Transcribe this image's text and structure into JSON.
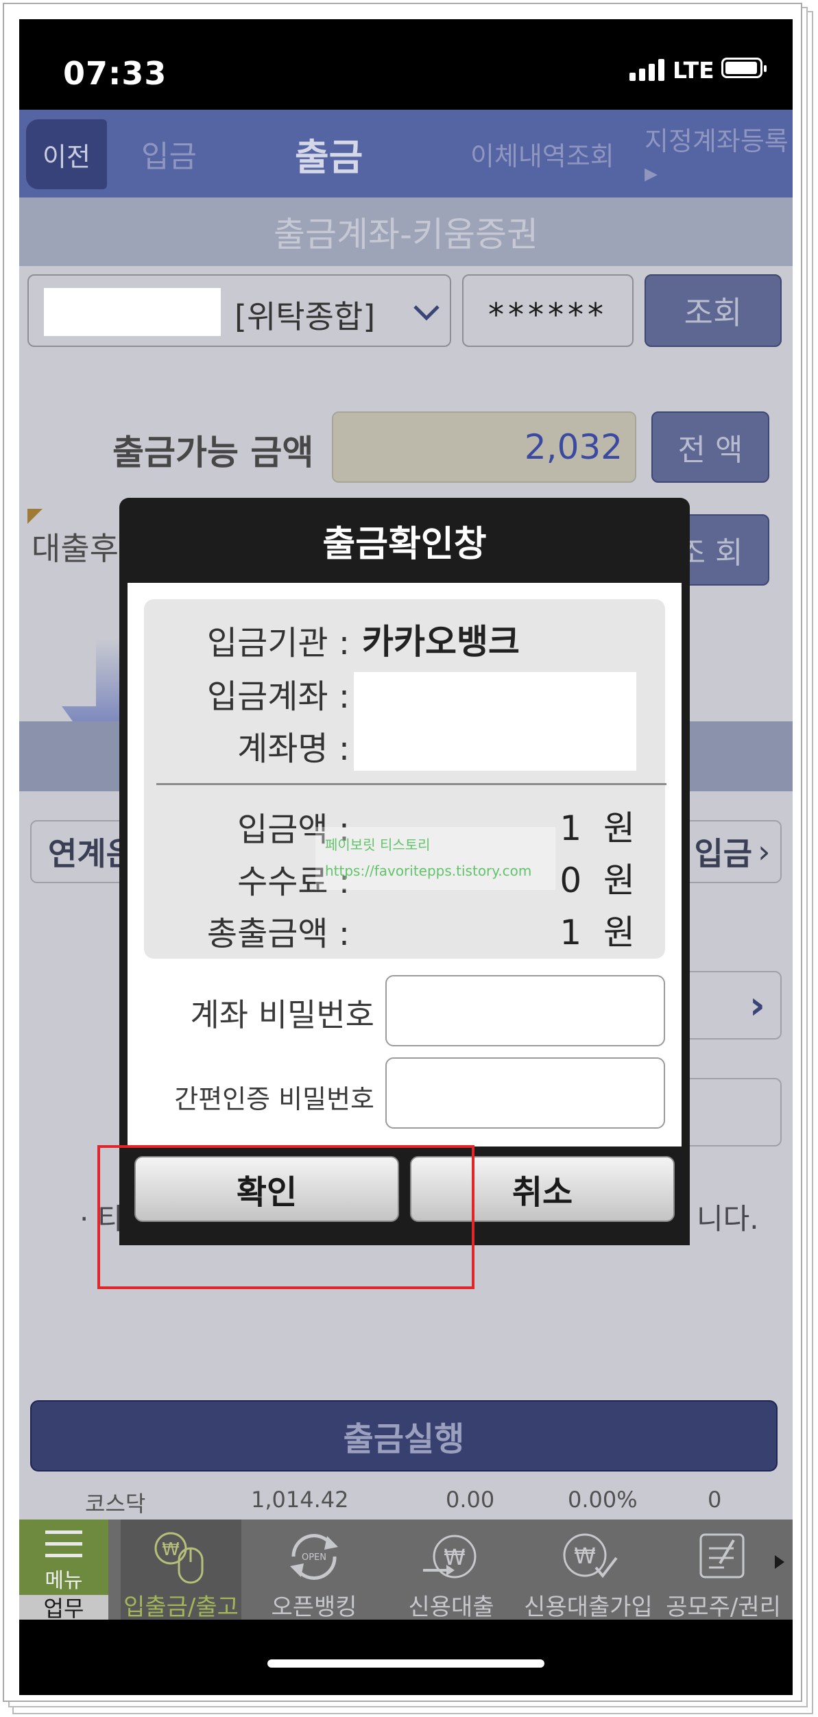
{
  "status_bar": {
    "time": "07:33",
    "network": "LTE"
  },
  "top_nav": {
    "back": "이전",
    "tabs": [
      "입금",
      "출금",
      "이체내역조회",
      "지정계좌등록 ▸"
    ]
  },
  "section_title": "출금계좌-키움증권",
  "account": {
    "type": "[위탁종합]",
    "password_mask": "******",
    "lookup_button": "조회"
  },
  "withdrawable": {
    "label": "출금가능 금액",
    "value": "2,032",
    "all_button": "전 액"
  },
  "after_loan": {
    "label": "대출후 출금가능 금액",
    "lookup_button": "조 회"
  },
  "background_rows": {
    "linked_label": "연계은",
    "deposit_link": "입금",
    "note_prefix": "· 타",
    "note_suffix": "니다."
  },
  "dialog": {
    "title": "출금확인창",
    "bank_label": "입금기관 :",
    "bank_value": "카카오뱅크",
    "account_label": "입금계좌 :",
    "account_name_label": "계좌명 :",
    "deposit_amount_label": "입금액 :",
    "deposit_amount": "1",
    "fee_label": "수수료 :",
    "fee": "0",
    "total_label": "총출금액 :",
    "total": "1",
    "currency": "원",
    "account_password_label": "계좌 비밀번호",
    "simple_auth_label": "간편인증 비밀번호",
    "confirm_button": "확인",
    "cancel_button": "취소"
  },
  "watermark": {
    "line1": "페이보릿 티스토리",
    "line2": "https://favoritepps.tistory.com"
  },
  "execute_button": "출금실행",
  "ticker": {
    "name": "코스닥",
    "value": "1,014.42",
    "change": "0.00",
    "rate": "0.00%",
    "volume": "0"
  },
  "bottom_nav": {
    "menu_label": "메뉴",
    "work_label": "업무",
    "items": [
      {
        "label": "입출금/출고",
        "icon": "mouse-won-icon"
      },
      {
        "label": "오픈뱅킹",
        "icon": "open-refresh-icon"
      },
      {
        "label": "신용대출",
        "icon": "won-arrow-icon"
      },
      {
        "label": "신용대출가입",
        "icon": "won-check-icon"
      },
      {
        "label": "공모주/권리",
        "icon": "document-edit-icon"
      }
    ]
  },
  "colors": {
    "nav_blue": "#5564a2",
    "highlight_red": "#e0262b",
    "active_tab_text": "#a3b65a"
  }
}
